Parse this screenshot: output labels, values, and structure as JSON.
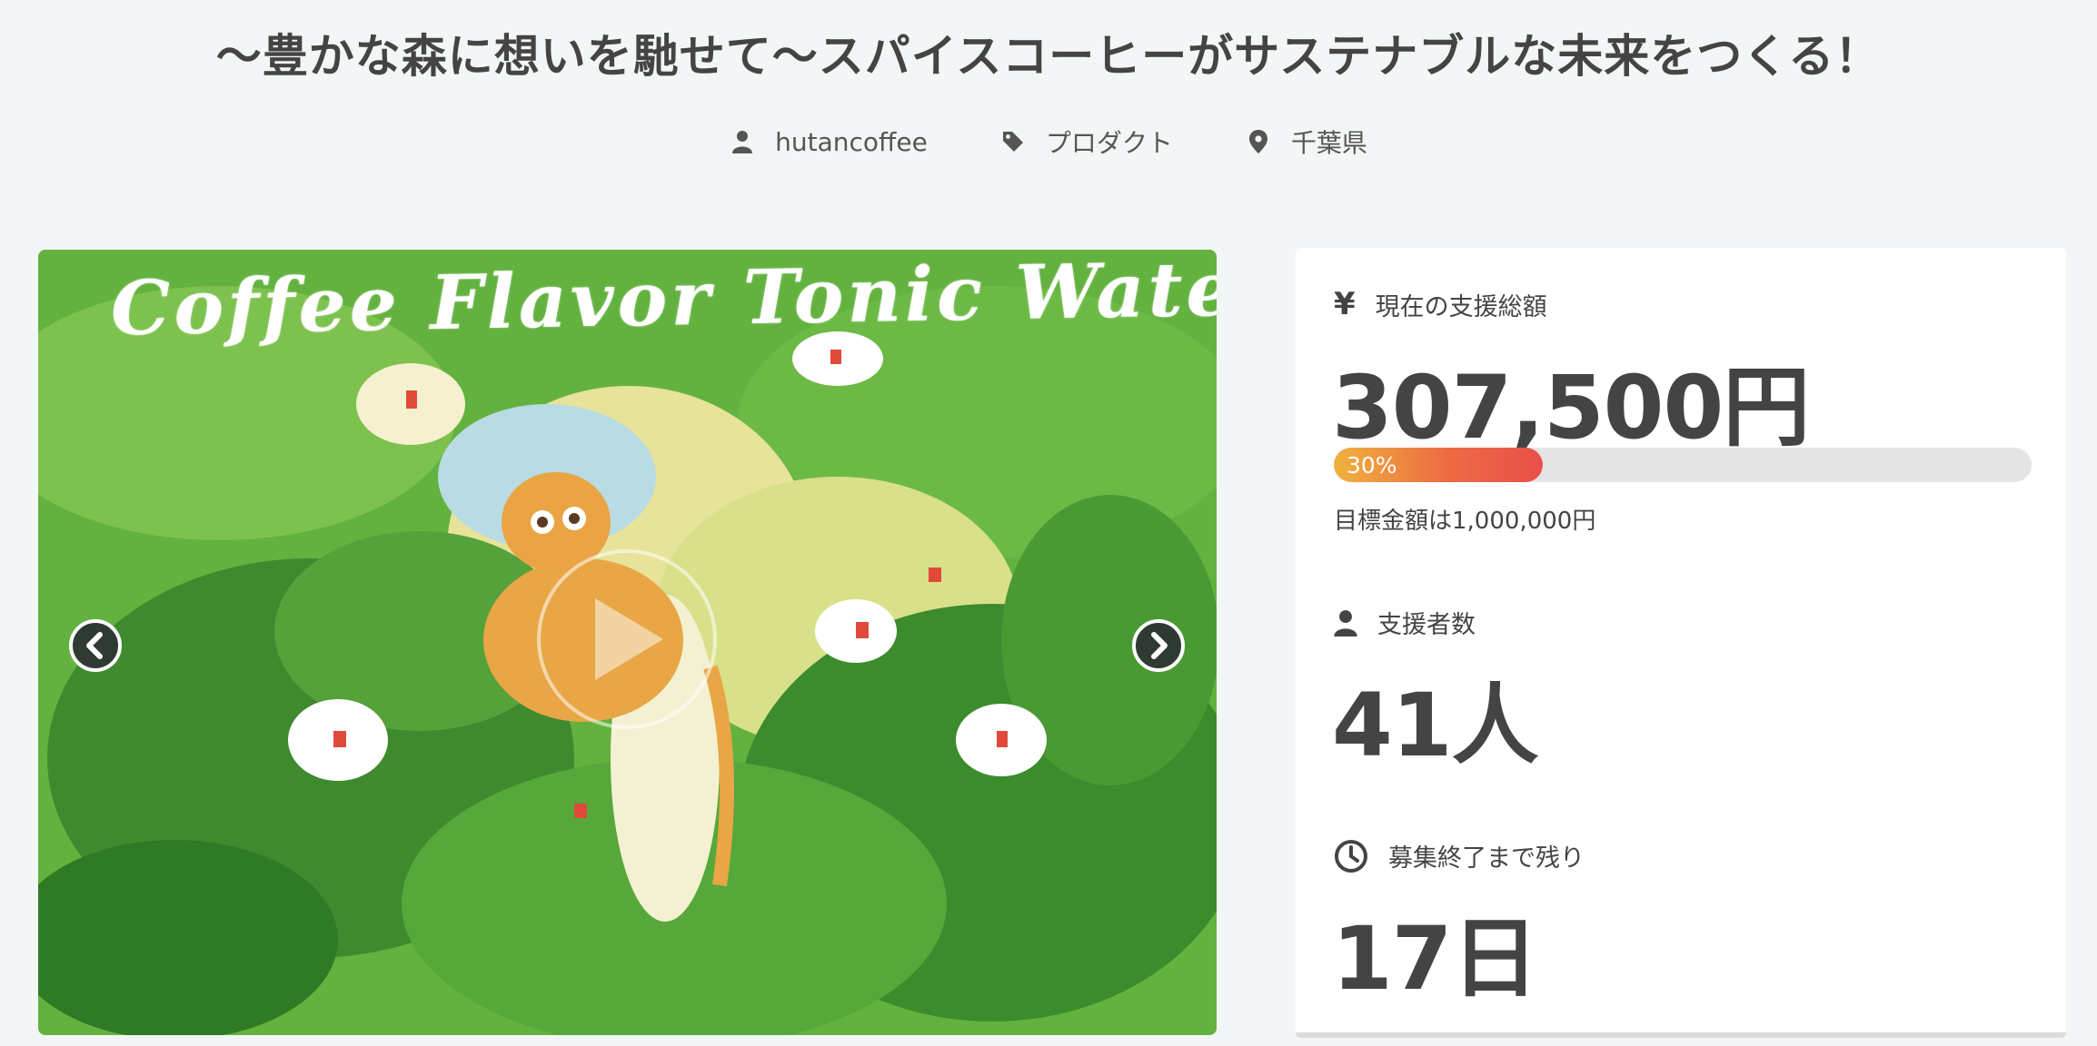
{
  "project": {
    "title": "〜豊かな森に想いを馳せて〜スパイスコーヒーがサステナブルな未来をつくる！",
    "owner": "hutancoffee",
    "category": "プロダクト",
    "location": "千葉県"
  },
  "media": {
    "art_title": "Coffee Flavor Tonic Water",
    "prev_icon": "chevron-left-icon",
    "next_icon": "chevron-right-icon",
    "play_icon": "play-icon"
  },
  "stats": {
    "funding": {
      "label": "現在の支援総額",
      "icon": "yen-icon",
      "icon_glyph": "¥",
      "amount": "307,500円",
      "progress_percent": 30,
      "progress_label": "30%",
      "goal_text": "目標金額は1,000,000円"
    },
    "supporters": {
      "label": "支援者数",
      "icon": "user-icon",
      "value": "41人"
    },
    "remaining": {
      "label": "募集終了まで残り",
      "icon": "clock-icon",
      "value": "17日"
    }
  },
  "colors": {
    "background": "#f3f6f7",
    "text": "#444444",
    "progress_start": "#f0b23e",
    "progress_end": "#e8504a",
    "progress_track": "#e5e5e5"
  }
}
